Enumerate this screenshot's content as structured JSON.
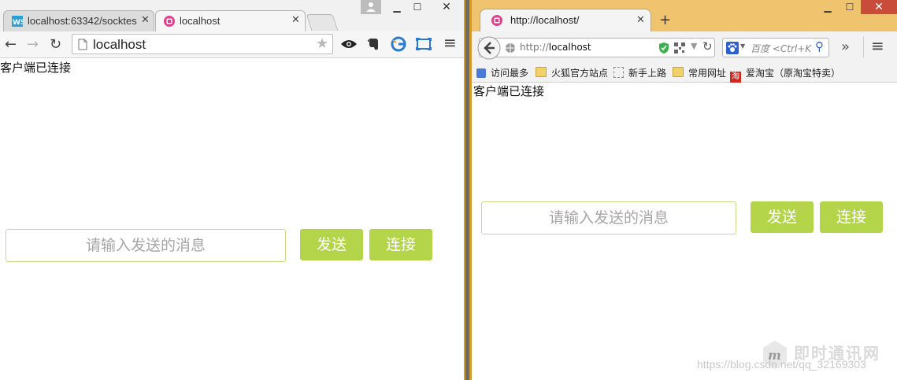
{
  "chrome": {
    "tabs": [
      {
        "label": "localhost:63342/socktes",
        "icon": "webstorm-icon",
        "active": false
      },
      {
        "label": "localhost",
        "icon": "app-icon",
        "active": true
      }
    ],
    "address": "localhost",
    "status_text": "客户端已连接",
    "message_input": {
      "placeholder": "请输入发送的消息",
      "value": ""
    },
    "send_label": "发送",
    "connect_label": "连接"
  },
  "firefox": {
    "tab_label": "http://localhost/",
    "address_prefix": "http://",
    "address_host": "localhost",
    "search_placeholder": "百度 <Ctrl+K",
    "bookmarks": [
      {
        "label": "访问最多",
        "icon": "page-icon"
      },
      {
        "label": "火狐官方站点",
        "icon": "folder-icon"
      },
      {
        "label": "新手上路",
        "icon": "blank-page-icon"
      },
      {
        "label": "常用网址",
        "icon": "folder-icon"
      },
      {
        "label": "爱淘宝（原淘宝特卖）",
        "icon": "taobao-icon"
      }
    ],
    "status_text": "客户端已连接",
    "message_input": {
      "placeholder": "请输入发送的消息",
      "value": ""
    },
    "send_label": "发送",
    "connect_label": "连接"
  },
  "watermark": {
    "url": "https://blog.csdn.net/qq_32169303",
    "brand": "即时通讯网"
  },
  "colors": {
    "button_green": "#b4d449",
    "input_border": "#c6d985",
    "firefox_titlebar": "#f0c46e"
  }
}
